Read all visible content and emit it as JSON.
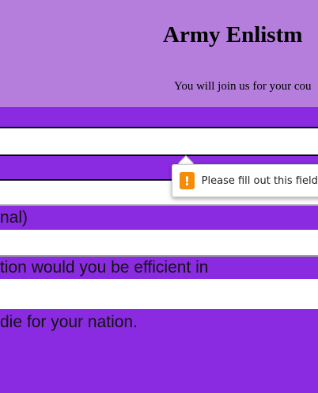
{
  "header": {
    "title": "Army Enlistm",
    "subtitle": "You will join us for your cou"
  },
  "form": {
    "label_nal": "nal)",
    "label_position": "tion would you be efficient in",
    "label_die": "die for your nation."
  },
  "validation_tooltip": {
    "icon": "warning-icon",
    "icon_glyph": "!",
    "message": "Please fill out this field."
  },
  "colors": {
    "header_bg": "#b57edc",
    "band_bg": "#8a2be2",
    "warning": "#f48c06"
  }
}
